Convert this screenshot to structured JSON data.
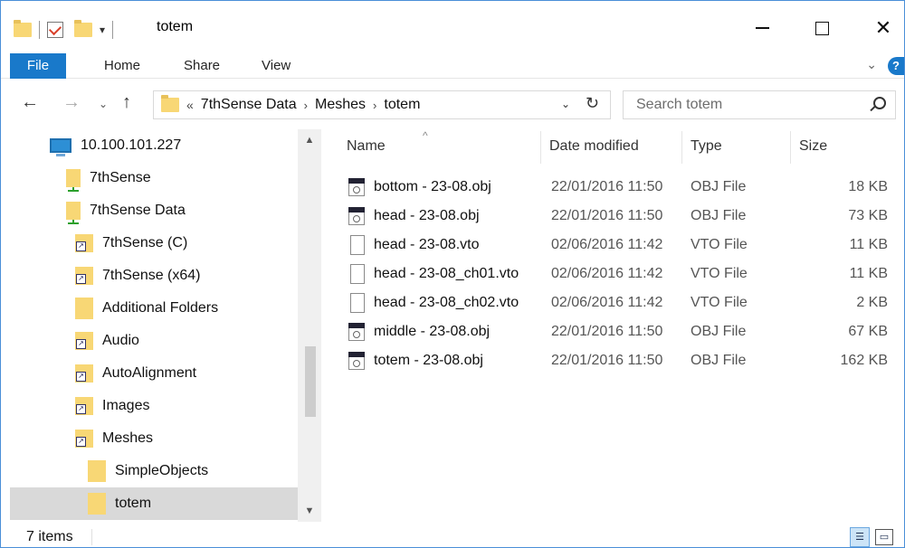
{
  "window": {
    "title": "totem"
  },
  "ribbon": {
    "tabs": [
      "File",
      "Home",
      "Share",
      "View"
    ]
  },
  "address": {
    "overflow": "«",
    "crumbs": [
      "7thSense Data",
      "Meshes",
      "totem"
    ]
  },
  "search": {
    "placeholder": "Search totem"
  },
  "nav_pane": {
    "items": [
      {
        "label": "10.100.101.227",
        "icon": "computer-icon"
      },
      {
        "label": "7thSense",
        "icon": "network-folder-icon"
      },
      {
        "label": "7thSense Data",
        "icon": "network-folder-icon"
      },
      {
        "label": "7thSense (C)",
        "icon": "shortcut-folder-icon"
      },
      {
        "label": "7thSense (x64)",
        "icon": "shortcut-folder-icon"
      },
      {
        "label": "Additional Folders",
        "icon": "folder-icon"
      },
      {
        "label": "Audio",
        "icon": "shortcut-folder-icon"
      },
      {
        "label": "AutoAlignment",
        "icon": "shortcut-folder-icon"
      },
      {
        "label": "Images",
        "icon": "shortcut-folder-icon"
      },
      {
        "label": "Meshes",
        "icon": "shortcut-folder-icon"
      },
      {
        "label": "SimpleObjects",
        "icon": "folder-icon"
      },
      {
        "label": "totem",
        "icon": "folder-icon",
        "selected": true
      }
    ]
  },
  "file_list": {
    "columns": [
      "Name",
      "Date modified",
      "Type",
      "Size"
    ],
    "rows": [
      {
        "name": "bottom - 23-08.obj",
        "date": "22/01/2016 11:50",
        "type": "OBJ File",
        "size": "18 KB",
        "icon": "obj-file-icon"
      },
      {
        "name": "head - 23-08.obj",
        "date": "22/01/2016 11:50",
        "type": "OBJ File",
        "size": "73 KB",
        "icon": "obj-file-icon"
      },
      {
        "name": "head - 23-08.vto",
        "date": "02/06/2016 11:42",
        "type": "VTO File",
        "size": "11 KB",
        "icon": "document-icon"
      },
      {
        "name": "head - 23-08_ch01.vto",
        "date": "02/06/2016 11:42",
        "type": "VTO File",
        "size": "11 KB",
        "icon": "document-icon"
      },
      {
        "name": "head - 23-08_ch02.vto",
        "date": "02/06/2016 11:42",
        "type": "VTO File",
        "size": "2 KB",
        "icon": "document-icon"
      },
      {
        "name": "middle - 23-08.obj",
        "date": "22/01/2016 11:50",
        "type": "OBJ File",
        "size": "67 KB",
        "icon": "obj-file-icon"
      },
      {
        "name": "totem - 23-08.obj",
        "date": "22/01/2016 11:50",
        "type": "OBJ File",
        "size": "162 KB",
        "icon": "obj-file-icon"
      }
    ]
  },
  "status": {
    "count": "7 items"
  },
  "colors": {
    "accent": "#1979ca",
    "folder": "#f8d775",
    "selected": "#d9d9d9"
  }
}
